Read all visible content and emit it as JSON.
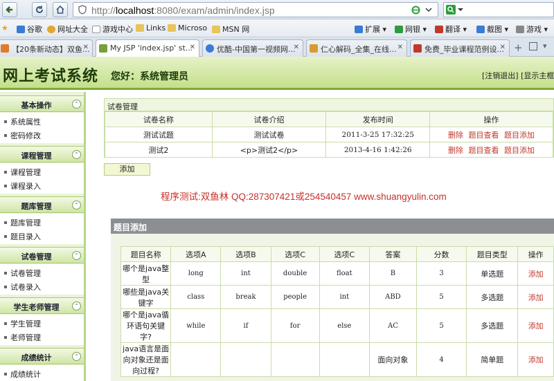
{
  "browser": {
    "url_prefix": "http://",
    "url_host": "localhost",
    "url_rest": ":8080/exam/admin/index.jsp",
    "bookmarks": [
      {
        "label": "★",
        "color": "#e5a700"
      },
      {
        "label": "谷歌",
        "color": "#3a7bd5"
      },
      {
        "label": "网址大全",
        "color": "#e2a72e"
      },
      {
        "label": "游戏中心",
        "color": "#bbbbbb"
      },
      {
        "label": "Links",
        "color": "#e8c45a"
      },
      {
        "label": "Microso",
        "color": "#e8c45a"
      },
      {
        "label": "MSN 网",
        "color": "#e8c45a"
      }
    ],
    "toolbar_right": [
      {
        "label": "扩展",
        "color": "#3a7bd5"
      },
      {
        "label": "网银",
        "color": "#2e9b3f"
      },
      {
        "label": "翻译",
        "color": "#c0392b"
      },
      {
        "label": "截图",
        "color": "#3a7bd5"
      },
      {
        "label": "游戏",
        "color": "#888888"
      }
    ],
    "tabs": [
      {
        "label": "【20条新动态】双鱼...",
        "color": "#e07b2a"
      },
      {
        "label": "My JSP 'index.jsp' st...",
        "color": "#7a9e3a"
      },
      {
        "label": "优酷-中国第一视频网...",
        "color": "#3a7bd5"
      },
      {
        "label": "仁心解码_全集_在线...",
        "color": "#d89b2e"
      },
      {
        "label": "免费_毕业课程范例设...",
        "color": "#c0392b"
      }
    ]
  },
  "header": {
    "title": "网上考试系统",
    "greeting": "您好：系统管理员",
    "links": "[注销退出] [显示主框架"
  },
  "sidebar": {
    "sections": [
      {
        "title": "基本操作",
        "items": [
          "系统属性",
          "密码修改"
        ]
      },
      {
        "title": "课程管理",
        "items": [
          "课程管理",
          "课程录入"
        ]
      },
      {
        "title": "题库管理",
        "items": [
          "题库管理",
          "题目录入"
        ]
      },
      {
        "title": "试卷管理",
        "items": [
          "试卷管理",
          "试卷录入"
        ]
      },
      {
        "title": "学生老师管理",
        "items": [
          "学生管理",
          "老师管理"
        ]
      },
      {
        "title": "成绩统计",
        "items": [
          "成绩统计"
        ]
      }
    ]
  },
  "exam": {
    "panel_title": "试卷管理",
    "columns": [
      "试卷名称",
      "试卷介绍",
      "发布时间",
      "操作"
    ],
    "rows": [
      {
        "name": "测试试题",
        "intro": "测试试卷",
        "time": "2011-3-25 17:32:25"
      },
      {
        "name": "测试2",
        "intro": "<p>测试2</p>",
        "time": "2013-4-16 1:42:26"
      }
    ],
    "ops": [
      "删除",
      "题目查看",
      "题目添加"
    ],
    "add_label": "添加"
  },
  "watermark": "程序测试:双鱼林 QQ:287307421或254540457 www.shuangyulin.com",
  "questions": {
    "panel_title": "题目添加",
    "columns": [
      "题目名称",
      "选项A",
      "选项B",
      "选项C",
      "选项C",
      "答案",
      "分数",
      "题目类型",
      "操作"
    ],
    "rows": [
      {
        "name": "哪个是java整型",
        "a": "long",
        "b": "int",
        "c": "double",
        "d": "float",
        "answer": "B",
        "score": "3",
        "type": "单选题",
        "op": "添加"
      },
      {
        "name": "哪些是java关键字",
        "a": "class",
        "b": "break",
        "c": "people",
        "d": "int",
        "answer": "ABD",
        "score": "5",
        "type": "多选题",
        "op": "添加"
      },
      {
        "name": "哪个是java循环语句关键字?",
        "a": "while",
        "b": "if",
        "c": "for",
        "d": "else",
        "answer": "AC",
        "score": "5",
        "type": "多选题",
        "op": "添加"
      },
      {
        "name": "java语言是面向对象还是面向过程?",
        "a": "",
        "b": "",
        "c": "",
        "d": "",
        "answer": "面向对象",
        "score": "4",
        "type": "简单题",
        "op": "添加"
      }
    ]
  }
}
